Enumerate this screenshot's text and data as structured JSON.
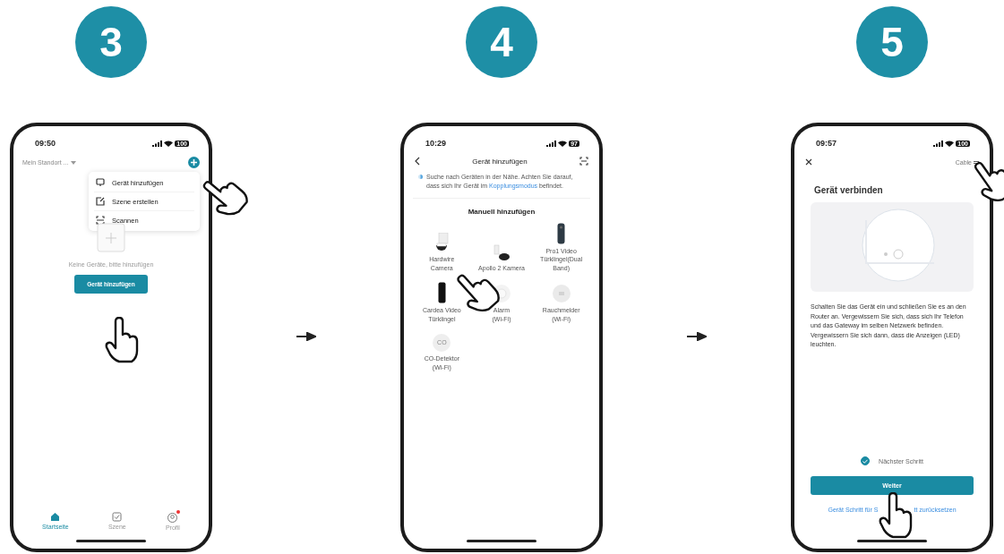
{
  "panels": [
    {
      "step": "3",
      "kind": "home",
      "status": {
        "time": "09:50",
        "battery": "100"
      },
      "location": "Mein Standort ...",
      "menu": [
        {
          "label": "Gerät hinzufügen"
        },
        {
          "label": "Szene erstellen"
        },
        {
          "label": "Scannen"
        }
      ],
      "empty_text": "Keine Geräte, bitte hinzufügen",
      "add_button": "Gerät hinzufügen",
      "tabs": [
        {
          "label": "Startseite",
          "selected": true,
          "badge": false
        },
        {
          "label": "Szene",
          "selected": false,
          "badge": false
        },
        {
          "label": "Profil",
          "selected": false,
          "badge": true
        }
      ]
    },
    {
      "step": "4",
      "kind": "add-device",
      "status": {
        "time": "10:29",
        "battery": "97"
      },
      "title": "Gerät hinzufügen",
      "info": {
        "before": "Suche nach Geräten in der Nähe. Achten Sie darauf, dass sich Ihr Gerät im ",
        "link": "Kopplungsmodus",
        "after": " befindet."
      },
      "section": "Manuell hinzufügen",
      "devices": [
        {
          "lines": [
            "Hardwire",
            "Camera"
          ]
        },
        {
          "lines": [
            "Apollo 2 Kamera"
          ]
        },
        {
          "lines": [
            "Pro1 Video",
            "Türklingel(Dual Band)"
          ]
        },
        {
          "lines": [
            "Cardea Video",
            "Türklingel"
          ]
        },
        {
          "lines": [
            "Alarm",
            "(Wi-Fi)"
          ]
        },
        {
          "lines": [
            "Rauchmelder",
            "(Wi-Fi)"
          ]
        },
        {
          "lines": [
            "CO-Detektor",
            "(Wi-Fi)"
          ],
          "icon_text": "CO"
        }
      ]
    },
    {
      "step": "5",
      "kind": "connect",
      "status": {
        "time": "09:57",
        "battery": "100"
      },
      "top_link": "Cable",
      "title": "Gerät verbinden",
      "text": "Schalten Sie das Gerät ein und schließen Sie es an den Router an. Vergewissern Sie sich, dass sich Ihr Telefon und das Gateway im selben Netzwerk befinden. Vergewissern Sie sich dann, dass die Anzeigen (LED) leuchten.",
      "next_step": {
        "label": "Nächster Schritt",
        "checked": true
      },
      "button": "Weiter",
      "reset_link": [
        "Gerät Schritt für S",
        "tt zurücksetzen"
      ]
    }
  ]
}
